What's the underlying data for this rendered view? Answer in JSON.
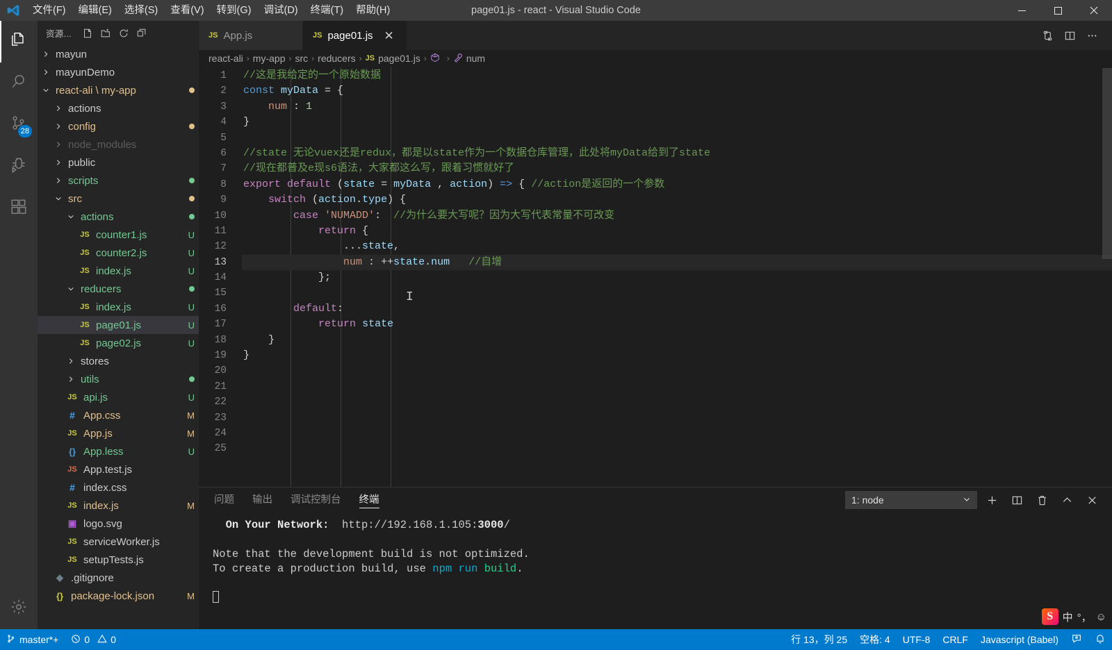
{
  "window": {
    "title": "page01.js - react - Visual Studio Code",
    "logo_icon": "vscode-logo",
    "minimize_label": "─",
    "maximize_label": "☐",
    "close_label": "✕"
  },
  "menubar": {
    "items": [
      {
        "label": "文件(F)"
      },
      {
        "label": "编辑(E)"
      },
      {
        "label": "选择(S)"
      },
      {
        "label": "查看(V)"
      },
      {
        "label": "转到(G)"
      },
      {
        "label": "调试(D)"
      },
      {
        "label": "终端(T)"
      },
      {
        "label": "帮助(H)"
      }
    ]
  },
  "activitybar": {
    "items": [
      {
        "name": "explorer",
        "icon": "files-icon",
        "active": true,
        "badge": null
      },
      {
        "name": "search",
        "icon": "search-icon",
        "active": false,
        "badge": null
      },
      {
        "name": "source-control",
        "icon": "source-control-icon",
        "active": false,
        "badge": "28"
      },
      {
        "name": "debug",
        "icon": "debug-icon",
        "active": false,
        "badge": null
      },
      {
        "name": "extensions",
        "icon": "extensions-icon",
        "active": false,
        "badge": null
      }
    ],
    "bottom": [
      {
        "name": "manage",
        "icon": "gear-icon"
      }
    ]
  },
  "sidebar": {
    "title": "资源...",
    "actions": [
      {
        "name": "new-file",
        "icon": "new-file-icon"
      },
      {
        "name": "new-folder",
        "icon": "new-folder-icon"
      },
      {
        "name": "refresh",
        "icon": "refresh-icon"
      },
      {
        "name": "collapse-all",
        "icon": "collapse-all-icon"
      }
    ],
    "tree": [
      {
        "label": "mayun",
        "indent": 1,
        "kind": "folder",
        "state": "collapsed",
        "color": "#cccccc",
        "badge": "",
        "dot": ""
      },
      {
        "label": "mayunDemo",
        "indent": 1,
        "kind": "folder",
        "state": "collapsed",
        "color": "#cccccc",
        "badge": "",
        "dot": ""
      },
      {
        "label": "react-ali \\ my-app",
        "indent": 1,
        "kind": "folder",
        "state": "expanded",
        "color": "#e2c08d",
        "badge": "",
        "dot": "#e2c08d"
      },
      {
        "label": "actions",
        "indent": 2,
        "kind": "folder",
        "state": "collapsed",
        "color": "#cccccc",
        "badge": "",
        "dot": ""
      },
      {
        "label": "config",
        "indent": 2,
        "kind": "folder",
        "state": "collapsed",
        "color": "#e2c08d",
        "badge": "",
        "dot": "#e2c08d"
      },
      {
        "label": "node_modules",
        "indent": 2,
        "kind": "folder",
        "state": "collapsed",
        "color": "#8a8a8a",
        "badge": "",
        "dot": "",
        "faded": true
      },
      {
        "label": "public",
        "indent": 2,
        "kind": "folder",
        "state": "collapsed",
        "color": "#cccccc",
        "badge": "",
        "dot": ""
      },
      {
        "label": "scripts",
        "indent": 2,
        "kind": "folder",
        "state": "collapsed",
        "color": "#73c991",
        "badge": "",
        "dot": "#73c991"
      },
      {
        "label": "src",
        "indent": 2,
        "kind": "folder",
        "state": "expanded",
        "color": "#e2c08d",
        "badge": "",
        "dot": "#e2c08d"
      },
      {
        "label": "actions",
        "indent": 3,
        "kind": "folder",
        "state": "expanded",
        "color": "#73c991",
        "badge": "",
        "dot": "#73c991"
      },
      {
        "label": "counter1.js",
        "indent": 4,
        "kind": "js",
        "state": "",
        "color": "#73c991",
        "badge": "U",
        "dot": ""
      },
      {
        "label": "counter2.js",
        "indent": 4,
        "kind": "js",
        "state": "",
        "color": "#73c991",
        "badge": "U",
        "dot": ""
      },
      {
        "label": "index.js",
        "indent": 4,
        "kind": "js",
        "state": "",
        "color": "#73c991",
        "badge": "U",
        "dot": ""
      },
      {
        "label": "reducers",
        "indent": 3,
        "kind": "folder",
        "state": "expanded",
        "color": "#73c991",
        "badge": "",
        "dot": "#73c991"
      },
      {
        "label": "index.js",
        "indent": 4,
        "kind": "js",
        "state": "",
        "color": "#73c991",
        "badge": "U",
        "dot": ""
      },
      {
        "label": "page01.js",
        "indent": 4,
        "kind": "js",
        "state": "",
        "color": "#73c991",
        "badge": "U",
        "dot": "",
        "selected": true
      },
      {
        "label": "page02.js",
        "indent": 4,
        "kind": "js",
        "state": "",
        "color": "#73c991",
        "badge": "U",
        "dot": ""
      },
      {
        "label": "stores",
        "indent": 3,
        "kind": "folder",
        "state": "collapsed",
        "color": "#cccccc",
        "badge": "",
        "dot": ""
      },
      {
        "label": "utils",
        "indent": 3,
        "kind": "folder",
        "state": "collapsed",
        "color": "#73c991",
        "badge": "",
        "dot": "#73c991"
      },
      {
        "label": "api.js",
        "indent": 3,
        "kind": "js",
        "state": "",
        "color": "#73c991",
        "badge": "U",
        "dot": ""
      },
      {
        "label": "App.css",
        "indent": 3,
        "kind": "css",
        "state": "",
        "color": "#e2c08d",
        "badge": "M",
        "dot": ""
      },
      {
        "label": "App.js",
        "indent": 3,
        "kind": "js",
        "state": "",
        "color": "#e2c08d",
        "badge": "M",
        "dot": ""
      },
      {
        "label": "App.less",
        "indent": 3,
        "kind": "less",
        "state": "",
        "color": "#73c991",
        "badge": "U",
        "dot": ""
      },
      {
        "label": "App.test.js",
        "indent": 3,
        "kind": "jstest",
        "state": "",
        "color": "#cccccc",
        "badge": "",
        "dot": ""
      },
      {
        "label": "index.css",
        "indent": 3,
        "kind": "css",
        "state": "",
        "color": "#cccccc",
        "badge": "",
        "dot": ""
      },
      {
        "label": "index.js",
        "indent": 3,
        "kind": "js",
        "state": "",
        "color": "#e2c08d",
        "badge": "M",
        "dot": ""
      },
      {
        "label": "logo.svg",
        "indent": 3,
        "kind": "svg",
        "state": "",
        "color": "#cccccc",
        "badge": "",
        "dot": ""
      },
      {
        "label": "serviceWorker.js",
        "indent": 3,
        "kind": "js",
        "state": "",
        "color": "#cccccc",
        "badge": "",
        "dot": ""
      },
      {
        "label": "setupTests.js",
        "indent": 3,
        "kind": "js",
        "state": "",
        "color": "#cccccc",
        "badge": "",
        "dot": ""
      },
      {
        "label": ".gitignore",
        "indent": 2,
        "kind": "git",
        "state": "",
        "color": "#cccccc",
        "badge": "",
        "dot": ""
      },
      {
        "label": "package-lock.json",
        "indent": 2,
        "kind": "json",
        "state": "",
        "color": "#e2c08d",
        "badge": "M",
        "dot": ""
      }
    ]
  },
  "tabs": [
    {
      "label": "App.js",
      "icon": "js-icon",
      "active": false,
      "closable": false
    },
    {
      "label": "page01.js",
      "icon": "js-icon",
      "active": true,
      "closable": true,
      "close_label": "✕"
    }
  ],
  "tab_actions": [
    {
      "name": "split-compare",
      "icon": "compare-icon"
    },
    {
      "name": "split-editor",
      "icon": "split-editor-icon"
    },
    {
      "name": "more-actions",
      "icon": "ellipsis-icon"
    }
  ],
  "breadcrumb": {
    "separator": "›",
    "items": [
      {
        "label": "react-ali",
        "icon": ""
      },
      {
        "label": "my-app",
        "icon": ""
      },
      {
        "label": "src",
        "icon": ""
      },
      {
        "label": "reducers",
        "icon": ""
      },
      {
        "label": "page01.js",
        "icon": "js-icon"
      },
      {
        "label": "<function>",
        "icon": "symbol-function-icon"
      },
      {
        "label": "num",
        "icon": "symbol-property-icon"
      }
    ]
  },
  "editor": {
    "total_lines": 25,
    "current_line": 13,
    "lines": [
      {
        "n": 1,
        "tokens": [
          {
            "t": "//这是我给定的一个原始数据",
            "c": "cmt"
          }
        ]
      },
      {
        "n": 2,
        "tokens": [
          {
            "t": "const",
            "c": "kw"
          },
          {
            "t": " ",
            "c": "op"
          },
          {
            "t": "myData",
            "c": "var"
          },
          {
            "t": " = {",
            "c": "op"
          }
        ]
      },
      {
        "n": 3,
        "tokens": [
          {
            "t": "    ",
            "c": "op"
          },
          {
            "t": "num",
            "c": "str"
          },
          {
            "t": " : ",
            "c": "op"
          },
          {
            "t": "1",
            "c": "num"
          }
        ]
      },
      {
        "n": 4,
        "tokens": [
          {
            "t": "}",
            "c": "op"
          }
        ]
      },
      {
        "n": 5,
        "tokens": []
      },
      {
        "n": 6,
        "tokens": [
          {
            "t": "//state 无论vuex还是redux，都是以state作为一个数据仓库管理，此处将myData给到了state",
            "c": "cmt"
          }
        ]
      },
      {
        "n": 7,
        "tokens": [
          {
            "t": "//现在都普及e现s6语法，大家都这么写，跟着习惯就好了",
            "c": "cmt"
          }
        ]
      },
      {
        "n": 8,
        "tokens": [
          {
            "t": "export",
            "c": "kw2"
          },
          {
            "t": " ",
            "c": "op"
          },
          {
            "t": "default",
            "c": "kw2"
          },
          {
            "t": " (",
            "c": "op"
          },
          {
            "t": "state",
            "c": "var"
          },
          {
            "t": " = ",
            "c": "op"
          },
          {
            "t": "myData",
            "c": "var"
          },
          {
            "t": " , ",
            "c": "op"
          },
          {
            "t": "action",
            "c": "var"
          },
          {
            "t": ") ",
            "c": "op"
          },
          {
            "t": "=>",
            "c": "kw"
          },
          {
            "t": " { ",
            "c": "op"
          },
          {
            "t": "//action是返回的一个参数",
            "c": "cmt"
          }
        ]
      },
      {
        "n": 9,
        "tokens": [
          {
            "t": "    ",
            "c": "op"
          },
          {
            "t": "switch",
            "c": "kw2"
          },
          {
            "t": " (",
            "c": "op"
          },
          {
            "t": "action",
            "c": "var"
          },
          {
            "t": ".",
            "c": "op"
          },
          {
            "t": "type",
            "c": "var"
          },
          {
            "t": ") {",
            "c": "op"
          }
        ]
      },
      {
        "n": 10,
        "tokens": [
          {
            "t": "        ",
            "c": "op"
          },
          {
            "t": "case",
            "c": "kw2"
          },
          {
            "t": " ",
            "c": "op"
          },
          {
            "t": "'NUMADD'",
            "c": "str"
          },
          {
            "t": ":  ",
            "c": "op"
          },
          {
            "t": "//为什么要大写呢？因为大写代表常量不可改变",
            "c": "cmt"
          }
        ]
      },
      {
        "n": 11,
        "tokens": [
          {
            "t": "            ",
            "c": "op"
          },
          {
            "t": "return",
            "c": "kw2"
          },
          {
            "t": " {",
            "c": "op"
          }
        ]
      },
      {
        "n": 12,
        "tokens": [
          {
            "t": "                ...",
            "c": "op"
          },
          {
            "t": "state",
            "c": "var"
          },
          {
            "t": ",",
            "c": "op"
          }
        ]
      },
      {
        "n": 13,
        "tokens": [
          {
            "t": "                ",
            "c": "op"
          },
          {
            "t": "num",
            "c": "str"
          },
          {
            "t": " : ",
            "c": "op"
          },
          {
            "t": "++",
            "c": "op"
          },
          {
            "t": "state",
            "c": "var"
          },
          {
            "t": ".",
            "c": "op"
          },
          {
            "t": "num",
            "c": "var"
          },
          {
            "t": "   ",
            "c": "op"
          },
          {
            "t": "//自增",
            "c": "cmt"
          }
        ]
      },
      {
        "n": 14,
        "tokens": [
          {
            "t": "            };",
            "c": "op"
          }
        ]
      },
      {
        "n": 15,
        "tokens": []
      },
      {
        "n": 16,
        "tokens": [
          {
            "t": "        ",
            "c": "op"
          },
          {
            "t": "default",
            "c": "kw2"
          },
          {
            "t": ":",
            "c": "op"
          }
        ]
      },
      {
        "n": 17,
        "tokens": [
          {
            "t": "            ",
            "c": "op"
          },
          {
            "t": "return",
            "c": "kw2"
          },
          {
            "t": " ",
            "c": "op"
          },
          {
            "t": "state",
            "c": "var"
          }
        ]
      },
      {
        "n": 18,
        "tokens": [
          {
            "t": "    }",
            "c": "op"
          }
        ]
      },
      {
        "n": 19,
        "tokens": [
          {
            "t": "}",
            "c": "op"
          }
        ]
      },
      {
        "n": 20,
        "tokens": []
      },
      {
        "n": 21,
        "tokens": []
      },
      {
        "n": 22,
        "tokens": []
      },
      {
        "n": 23,
        "tokens": []
      },
      {
        "n": 24,
        "tokens": []
      },
      {
        "n": 25,
        "tokens": []
      }
    ]
  },
  "panel": {
    "tabs": [
      {
        "label": "问题",
        "active": false
      },
      {
        "label": "输出",
        "active": false
      },
      {
        "label": "调试控制台",
        "active": false
      },
      {
        "label": "终端",
        "active": true
      }
    ],
    "terminal_select": {
      "value": "1: node",
      "chevron": "⌄"
    },
    "actions": [
      {
        "name": "new-terminal",
        "icon": "plus-icon"
      },
      {
        "name": "split-terminal",
        "icon": "split-icon"
      },
      {
        "name": "kill-terminal",
        "icon": "trash-icon"
      },
      {
        "name": "maximize-panel",
        "icon": "chevron-up-icon"
      },
      {
        "name": "close-panel",
        "icon": "close-icon"
      }
    ],
    "terminal_lines": [
      [
        {
          "t": "  ",
          "c": "plain"
        },
        {
          "t": "On Your Network:",
          "c": "bold"
        },
        {
          "t": "  http://192.168.1.105:",
          "c": "plain"
        },
        {
          "t": "3000",
          "c": "bold"
        },
        {
          "t": "/",
          "c": "plain"
        }
      ],
      [],
      [
        {
          "t": "Note that the development build is not optimized.",
          "c": "plain"
        }
      ],
      [
        {
          "t": "To create a production build, use ",
          "c": "plain"
        },
        {
          "t": "npm",
          "c": "cyan"
        },
        {
          "t": " ",
          "c": "plain"
        },
        {
          "t": "run",
          "c": "red"
        },
        {
          "t": " ",
          "c": "plain"
        },
        {
          "t": "build",
          "c": "green"
        },
        {
          "t": ".",
          "c": "plain"
        }
      ],
      [],
      [
        {
          "t": "█",
          "c": "cursor"
        }
      ]
    ]
  },
  "statusbar": {
    "left": [
      {
        "name": "branch",
        "icon": "source-control-icon",
        "label": "master*+"
      },
      {
        "name": "problems",
        "icon": "error-warning-icon",
        "label": "0  0",
        "error_count": "0",
        "warning_count": "0"
      }
    ],
    "right": [
      {
        "name": "cursor-position",
        "label": "行 13，列 25"
      },
      {
        "name": "indentation",
        "label": "空格: 4"
      },
      {
        "name": "encoding",
        "label": "UTF-8"
      },
      {
        "name": "eol",
        "label": "CRLF"
      },
      {
        "name": "language-mode",
        "label": "Javascript (Babel)"
      },
      {
        "name": "feedback",
        "icon": "feedback-icon",
        "label": ""
      },
      {
        "name": "notifications",
        "icon": "bell-icon",
        "label": ""
      }
    ]
  },
  "ime": {
    "logo": "S",
    "mode": "中",
    "punct": "°，",
    "emoji": "☺"
  },
  "colors": {
    "accent": "#007acc",
    "titlebar": "#3c3c3c",
    "activitybar": "#333333",
    "sidebar": "#252526",
    "editor": "#1e1e1e",
    "tab_inactive": "#2d2d2d",
    "badge_modified": "#e2c08d",
    "badge_untracked": "#73c991"
  }
}
